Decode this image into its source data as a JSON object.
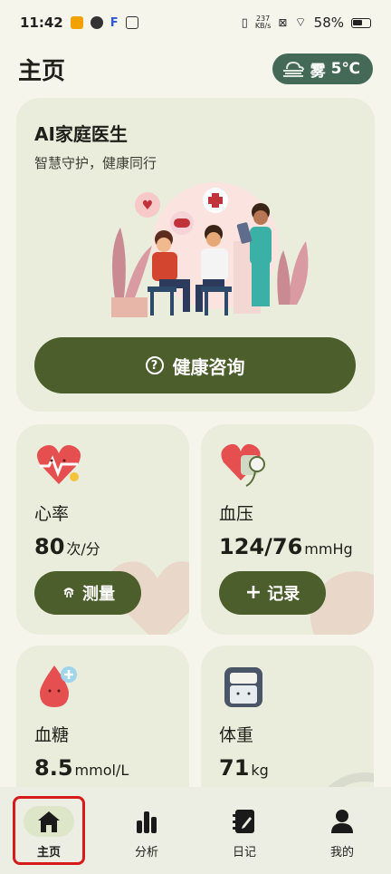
{
  "status_bar": {
    "time": "11:42",
    "net_speed_value": "237",
    "net_speed_unit": "KB/s",
    "battery": "58%"
  },
  "header": {
    "title": "主页",
    "weather": {
      "condition": "雾",
      "temperature": "5℃",
      "icon": "fog-icon"
    }
  },
  "hero": {
    "title": "AI家庭医生",
    "subtitle": "智慧守护，健康同行",
    "button_label": "健康咨询",
    "button_icon": "question-circle-icon"
  },
  "cards": [
    {
      "name": "心率",
      "value": "80",
      "unit": "次/分",
      "icon": "heart-rate-icon",
      "button_label": "测量",
      "button_icon": "fingerprint-icon"
    },
    {
      "name": "血压",
      "value": "124/76",
      "unit": "mmHg",
      "icon": "blood-pressure-icon",
      "button_label": "记录",
      "button_icon": "plus-icon"
    },
    {
      "name": "血糖",
      "value": "8.5",
      "unit": "mmol/L",
      "icon": "blood-drop-icon"
    },
    {
      "name": "体重",
      "value": "71",
      "unit": "kg",
      "icon": "scale-icon"
    }
  ],
  "bottom_nav": [
    {
      "label": "主页",
      "icon": "home-icon",
      "active": true
    },
    {
      "label": "分析",
      "icon": "bar-chart-icon",
      "active": false
    },
    {
      "label": "日记",
      "icon": "notebook-icon",
      "active": false
    },
    {
      "label": "我的",
      "icon": "profile-icon",
      "active": false
    }
  ],
  "colors": {
    "background": "#f5f5ec",
    "card": "#eaeddc",
    "primary_button": "#4b5e2b",
    "weather_chip": "#446a57",
    "highlight": "#d71a1a"
  }
}
